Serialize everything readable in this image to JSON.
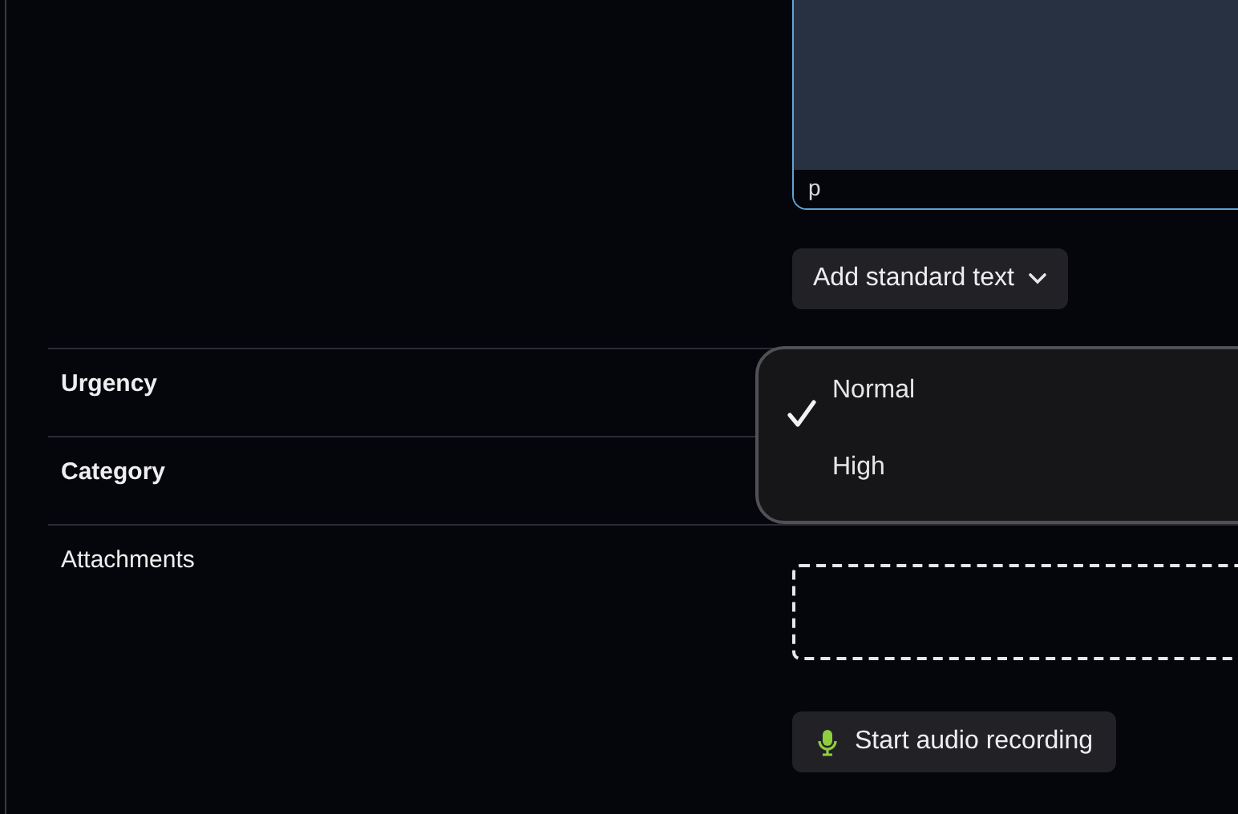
{
  "editor": {
    "path": "p"
  },
  "add_standard_text": {
    "label": "Add standard text"
  },
  "fields": [
    {
      "label": "Urgency",
      "kind": "bold"
    },
    {
      "label": "Category",
      "kind": "bold"
    },
    {
      "label": "Attachments",
      "kind": "plain"
    }
  ],
  "urgency_menu": {
    "options": [
      {
        "label": "Normal",
        "selected": true
      },
      {
        "label": "High",
        "selected": false
      }
    ]
  },
  "attachments": {
    "record_button": "Start audio recording"
  }
}
